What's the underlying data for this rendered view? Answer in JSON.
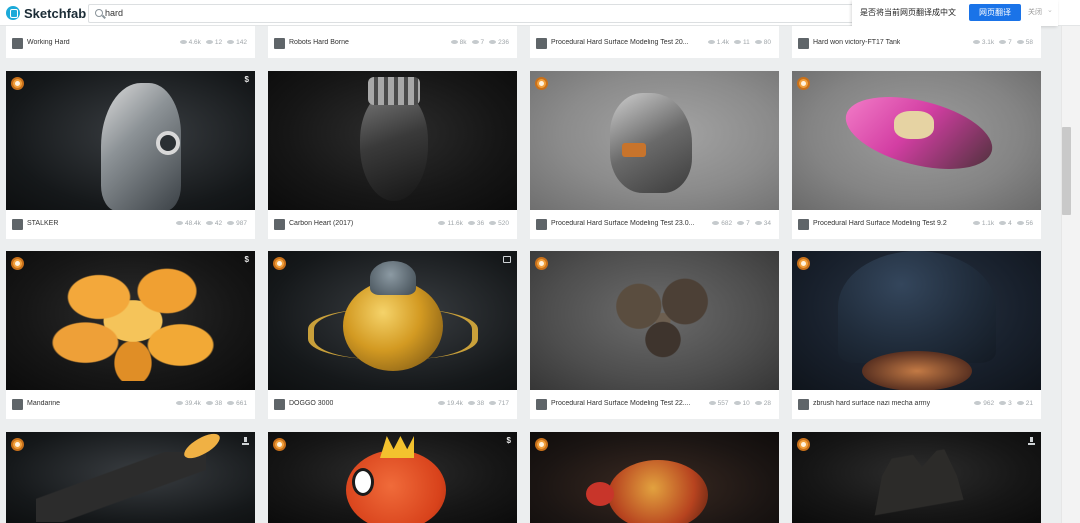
{
  "header": {
    "logo_text": "Sketchfab",
    "search_query": "hard"
  },
  "translate_popup": {
    "question": "是否将当前网页翻译成中文",
    "translate_button": "网页翻译",
    "close_button": "关闭"
  },
  "top_row": [
    {
      "title": "Working Hard",
      "views": "4.6k",
      "comments": "12",
      "likes": "142"
    },
    {
      "title": "Robots Hard Borne",
      "views": "8k",
      "comments": "7",
      "likes": "236"
    },
    {
      "title": "Procedural Hard Surface Modeling Test 20...",
      "views": "1.4k",
      "comments": "11",
      "likes": "80"
    },
    {
      "title": "Hard won victory-FT17 Tank",
      "views": "3.1k",
      "comments": "7",
      "likes": "58"
    }
  ],
  "rows": [
    [
      {
        "title": "STALKER",
        "views": "48.4k",
        "comments": "42",
        "likes": "987",
        "badge": "$",
        "staff_pick": true
      },
      {
        "title": "Carbon Heart (2017)",
        "views": "11.6k",
        "comments": "36",
        "likes": "520",
        "badge": "",
        "staff_pick": false
      },
      {
        "title": "Procedural Hard Surface Modeling Test 23.0...",
        "views": "682",
        "comments": "7",
        "likes": "34",
        "badge": "",
        "staff_pick": true
      },
      {
        "title": "Procedural Hard Surface Modeling Test 9.2",
        "views": "1.1k",
        "comments": "4",
        "likes": "56",
        "badge": "",
        "staff_pick": true
      }
    ],
    [
      {
        "title": "Mandarine",
        "views": "39.4k",
        "comments": "38",
        "likes": "661",
        "badge": "$",
        "staff_pick": true
      },
      {
        "title": "DOGGO 3000",
        "views": "19.4k",
        "comments": "38",
        "likes": "717",
        "badge": "vr",
        "staff_pick": true
      },
      {
        "title": "Procedural Hard Surface Modeling Test 22....",
        "views": "557",
        "comments": "10",
        "likes": "28",
        "badge": "",
        "staff_pick": true
      },
      {
        "title": "zbrush hard surface nazi mecha army",
        "views": "962",
        "comments": "3",
        "likes": "21",
        "badge": "",
        "staff_pick": true
      }
    ],
    [
      {
        "badge": "download",
        "staff_pick": true
      },
      {
        "badge": "$",
        "staff_pick": true
      },
      {
        "badge": "",
        "staff_pick": true
      },
      {
        "badge": "download",
        "staff_pick": true
      }
    ]
  ],
  "icons": {
    "view": "eye-icon",
    "comment": "comment-icon",
    "like": "heart-icon",
    "staff_pick": "staff-pick-icon",
    "download": "download-icon",
    "vr": "vr-icon"
  },
  "colors": {
    "brand": "#1caad9",
    "translate_button": "#1a73e8",
    "staff_pick": "#f2a03c"
  }
}
